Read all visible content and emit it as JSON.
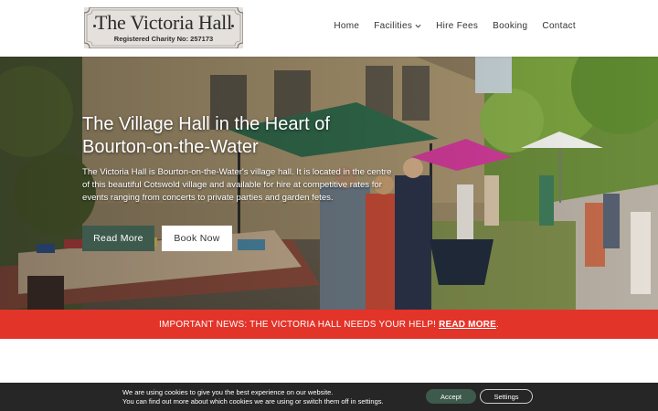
{
  "logo": {
    "title": "The Victoria Hall",
    "subtitle": "Registered Charity No: 257173"
  },
  "nav": {
    "items": [
      "Home",
      "Facilities",
      "Hire Fees",
      "Booking",
      "Contact"
    ]
  },
  "hero": {
    "title": "The Village Hall in the Heart of Bourton-on-the-Water",
    "description": "The Victoria Hall is Bourton-on-the-Water's village hall. It is located in the centre of this beautiful Cotswold village and available for hire at competitive rates for events ranging from concerts to private parties and garden fetes.",
    "read_more_label": "Read More",
    "book_now_label": "Book Now"
  },
  "notice": {
    "text": "IMPORTANT NEWS: THE VICTORIA HALL NEEDS YOUR HELP!",
    "link_label": "READ MORE",
    "color": "#e3342a"
  },
  "cookie": {
    "line1": "We are using cookies to give you the best experience on our website.",
    "line2": "You can find out more about which cookies we are using or switch them off in settings.",
    "accept_label": "Accept",
    "settings_label": "Settings"
  },
  "colors": {
    "accent_green": "#3e5a4c",
    "cookie_bg": "#262626"
  }
}
